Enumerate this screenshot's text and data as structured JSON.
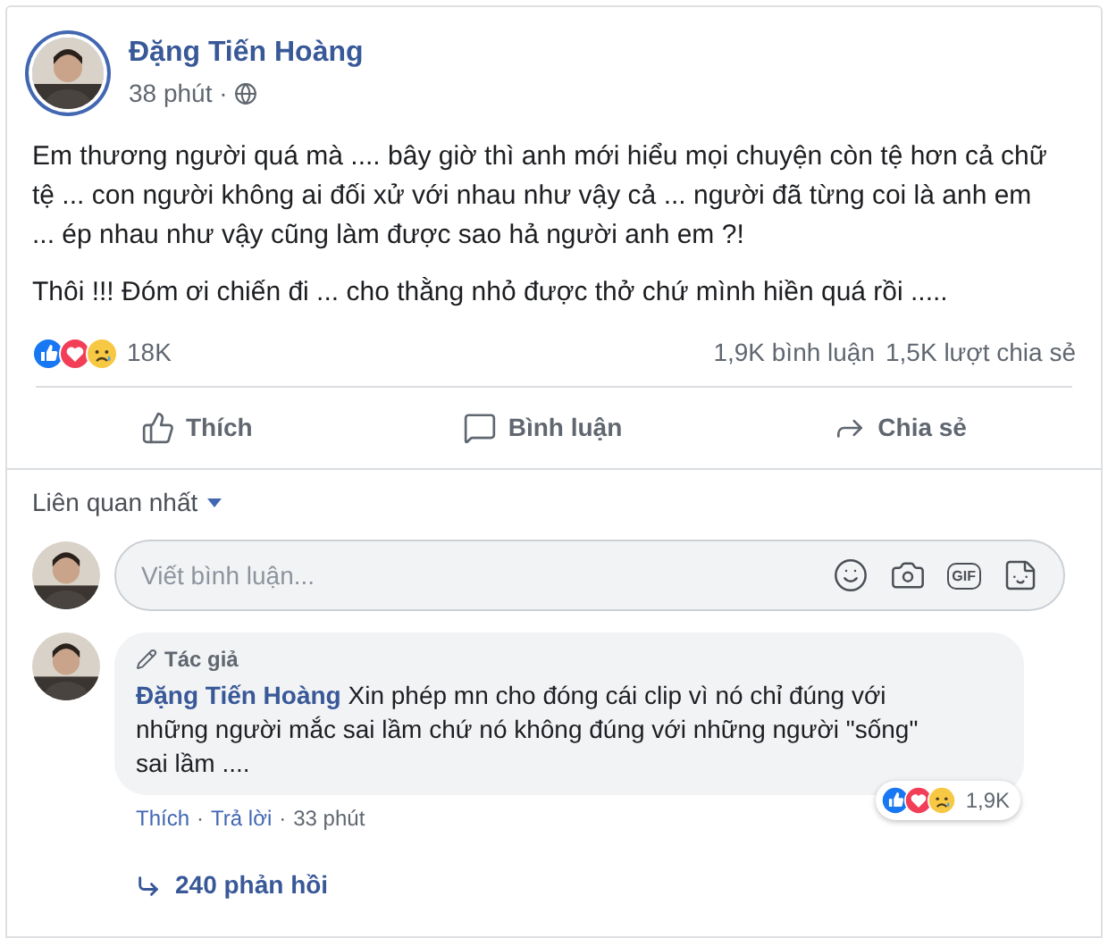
{
  "post": {
    "author": "Đặng Tiến Hoàng",
    "time": "38 phút",
    "paragraphs": [
      "Em thương người quá mà .... bây giờ thì anh mới hiểu mọi chuyện còn tệ hơn cả chữ tệ ... con người không ai đối xử với nhau như vậy cả ... người đã từng coi là anh em ... ép nhau như vậy cũng làm được sao hả người anh em ?!",
      "Thôi !!! Đóm ơi chiến đi ... cho thằng nhỏ được thở chứ mình hiền quá rồi ....."
    ],
    "reactions": [
      {
        "kind": "like"
      },
      {
        "kind": "love"
      },
      {
        "kind": "sad"
      }
    ],
    "separator": "·",
    "reaction_count": "18K",
    "comment_count": "1,9K bình luận",
    "share_count": "1,5K lượt chia sẻ",
    "actions": [
      {
        "kind": "like",
        "label": "Thích"
      },
      {
        "kind": "comment",
        "label": "Bình luận"
      },
      {
        "kind": "share",
        "label": "Chia sẻ"
      }
    ]
  },
  "sort": {
    "label": "Liên quan nhất"
  },
  "comment_box": {
    "placeholder": "Viết bình luận...",
    "gif_label": "GIF"
  },
  "comments": [
    {
      "badge": "Tác giả",
      "author": "Đặng Tiến Hoàng",
      "text": "Xin phép mn cho đóng cái clip vì nó chỉ đúng với những người mắc sai lầm chứ nó không đúng với những người \"sống\" sai lầm ....",
      "reactions": [
        {
          "kind": "like"
        },
        {
          "kind": "love"
        },
        {
          "kind": "sad"
        }
      ],
      "reaction_count": "1,9K",
      "actions": [
        "Thích",
        "Trả lời"
      ],
      "separator": "·",
      "time": "33 phút",
      "replies": "240 phản hồi"
    }
  ]
}
